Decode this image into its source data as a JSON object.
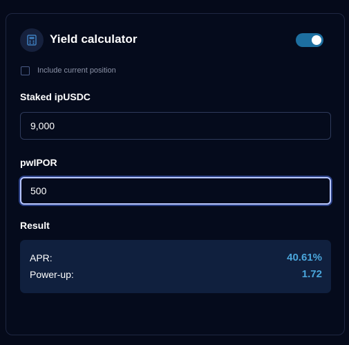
{
  "calculator": {
    "title": "Yield calculator",
    "icon": "calculator-icon",
    "toggle_on": true,
    "include_position": {
      "label": "Include current position",
      "checked": false
    },
    "staked": {
      "label": "Staked ipUSDC",
      "value": "9,000"
    },
    "pwipor": {
      "label": "pwIPOR",
      "value": "500"
    },
    "result": {
      "label": "Result",
      "rows": [
        {
          "key": "APR:",
          "value": "40.61%"
        },
        {
          "key": "Power-up:",
          "value": "1.72"
        }
      ]
    }
  },
  "colors": {
    "background": "#050a1a",
    "card": "#050b1c",
    "toggle": "#1d6fa0",
    "result_panel": "#10203e",
    "result_value": "#4aa6dc",
    "focus_border": "#b9c7ff"
  }
}
